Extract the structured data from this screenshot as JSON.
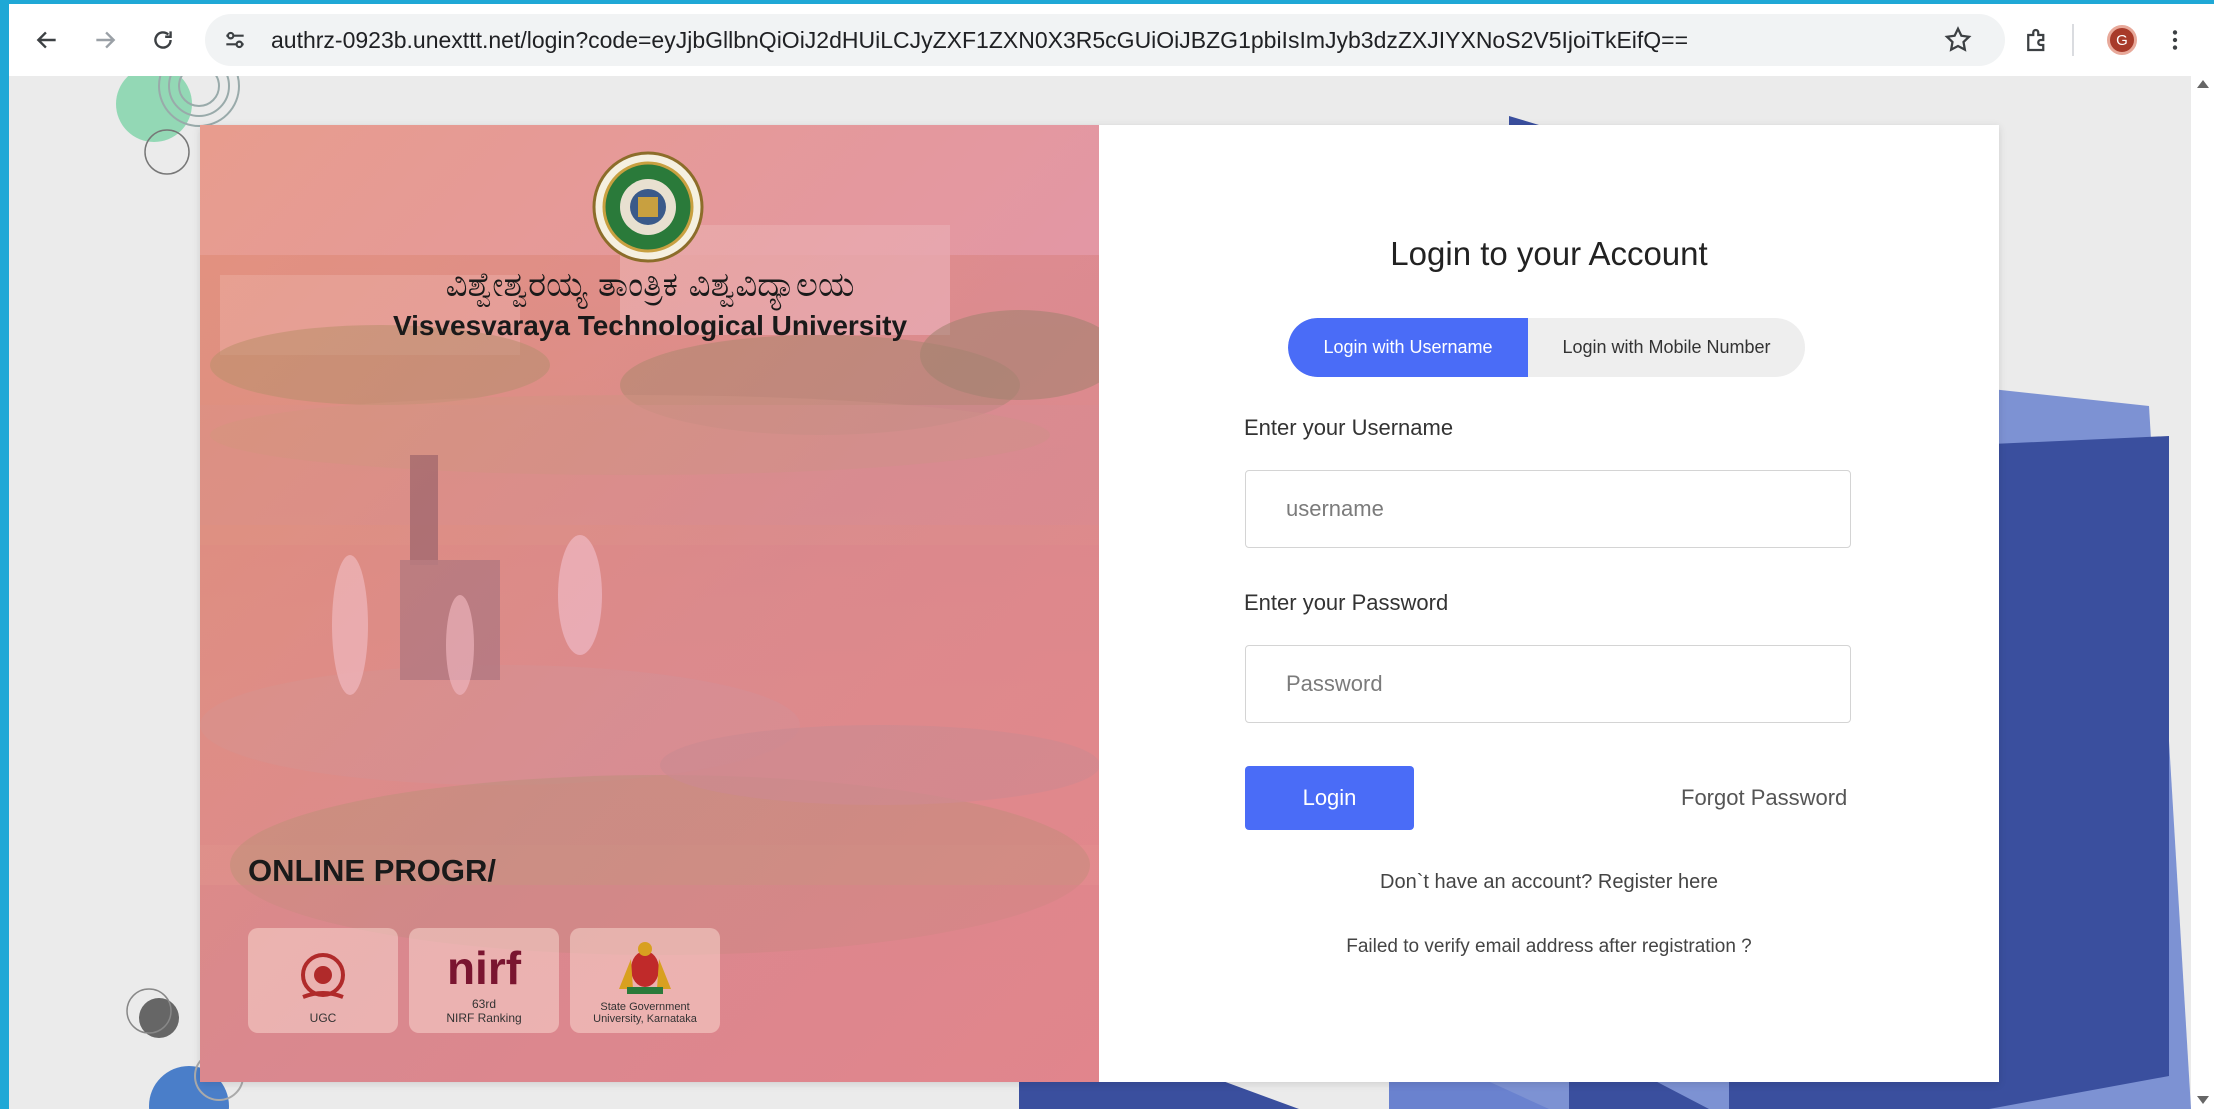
{
  "browser": {
    "url": "authrz-0923b.unexttt.net/login?code=eyJjbGllbnQiOiJ2dHUiLCJyZXF1ZXN0X3R5cGUiOiJBZG1pbiIsImJyb3dzZXJIYXNoS2V5IjoiTkEifQ==",
    "profile_initial": "G"
  },
  "hero": {
    "university_name_kannada": "ವಿಶ್ವೇಶ್ವರಯ್ಯ ತಾಂತ್ರಿಕ ವಿಶ್ವವಿದ್ಯಾಲಯ",
    "university_name_english": "Visvesvaraya Technological University",
    "program_heading": "ONLINE PROGR/",
    "badges": [
      {
        "label": "UGC"
      },
      {
        "logo_text": "nirf",
        "line1": "63rd",
        "line2": "NIRF Ranking"
      },
      {
        "line1": "State Government",
        "line2": "University, Karnataka"
      }
    ]
  },
  "login": {
    "title": "Login to your Account",
    "tabs": [
      "Login with Username",
      "Login with Mobile Number"
    ],
    "username_label": "Enter your Username",
    "username_placeholder": "username",
    "password_label": "Enter your Password",
    "password_placeholder": "Password",
    "login_button": "Login",
    "forgot_password": "Forgot Password",
    "register_text": "Don`t have an account? Register here",
    "verify_text": "Failed to verify email address after registration ?"
  },
  "colors": {
    "accent": "#4a6cf7",
    "slide_background": "#1fa8d6",
    "page_background": "#ebebeb",
    "decor_blue": "#3a4f9e"
  }
}
